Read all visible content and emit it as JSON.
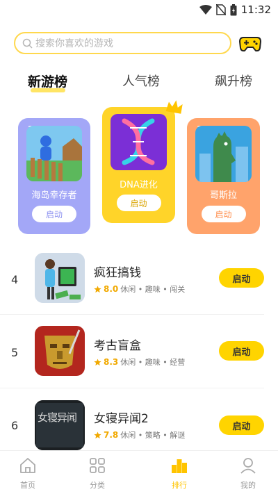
{
  "status": {
    "time": "11:32"
  },
  "search": {
    "placeholder": "搜索你喜欢的游戏"
  },
  "tabs": [
    {
      "label": "新游榜",
      "active": true
    },
    {
      "label": "人气榜",
      "active": false
    },
    {
      "label": "飙升榜",
      "active": false
    }
  ],
  "podium": [
    {
      "rank": "2",
      "name": "海岛幸存者",
      "button": "启动",
      "color": "#a3a7f7"
    },
    {
      "rank": "1",
      "name": "DNA进化",
      "button": "启动",
      "color": "#ffd429"
    },
    {
      "rank": "3",
      "name": "哥斯拉",
      "button": "启动",
      "color": "#ffa36b"
    }
  ],
  "list": [
    {
      "rank": "4",
      "title": "疯狂搞钱",
      "score": "8.0",
      "tags": "休闲 • 趣味 • 闯关",
      "button": "启动"
    },
    {
      "rank": "5",
      "title": "考古盲盒",
      "score": "8.3",
      "tags": "休闲 • 趣味 • 经营",
      "button": "启动"
    },
    {
      "rank": "6",
      "title": "女寝异闻2",
      "score": "7.8",
      "tags": "休闲 • 策略 • 解谜",
      "button": "启动"
    }
  ],
  "list_icon_text": {
    "horror": "女寝异闻"
  },
  "nav": [
    {
      "label": "首页",
      "active": false
    },
    {
      "label": "分类",
      "active": false
    },
    {
      "label": "排行",
      "active": true
    },
    {
      "label": "我的",
      "active": false
    }
  ],
  "colors": {
    "accent": "#ffd400",
    "active_nav": "#ffc400"
  }
}
